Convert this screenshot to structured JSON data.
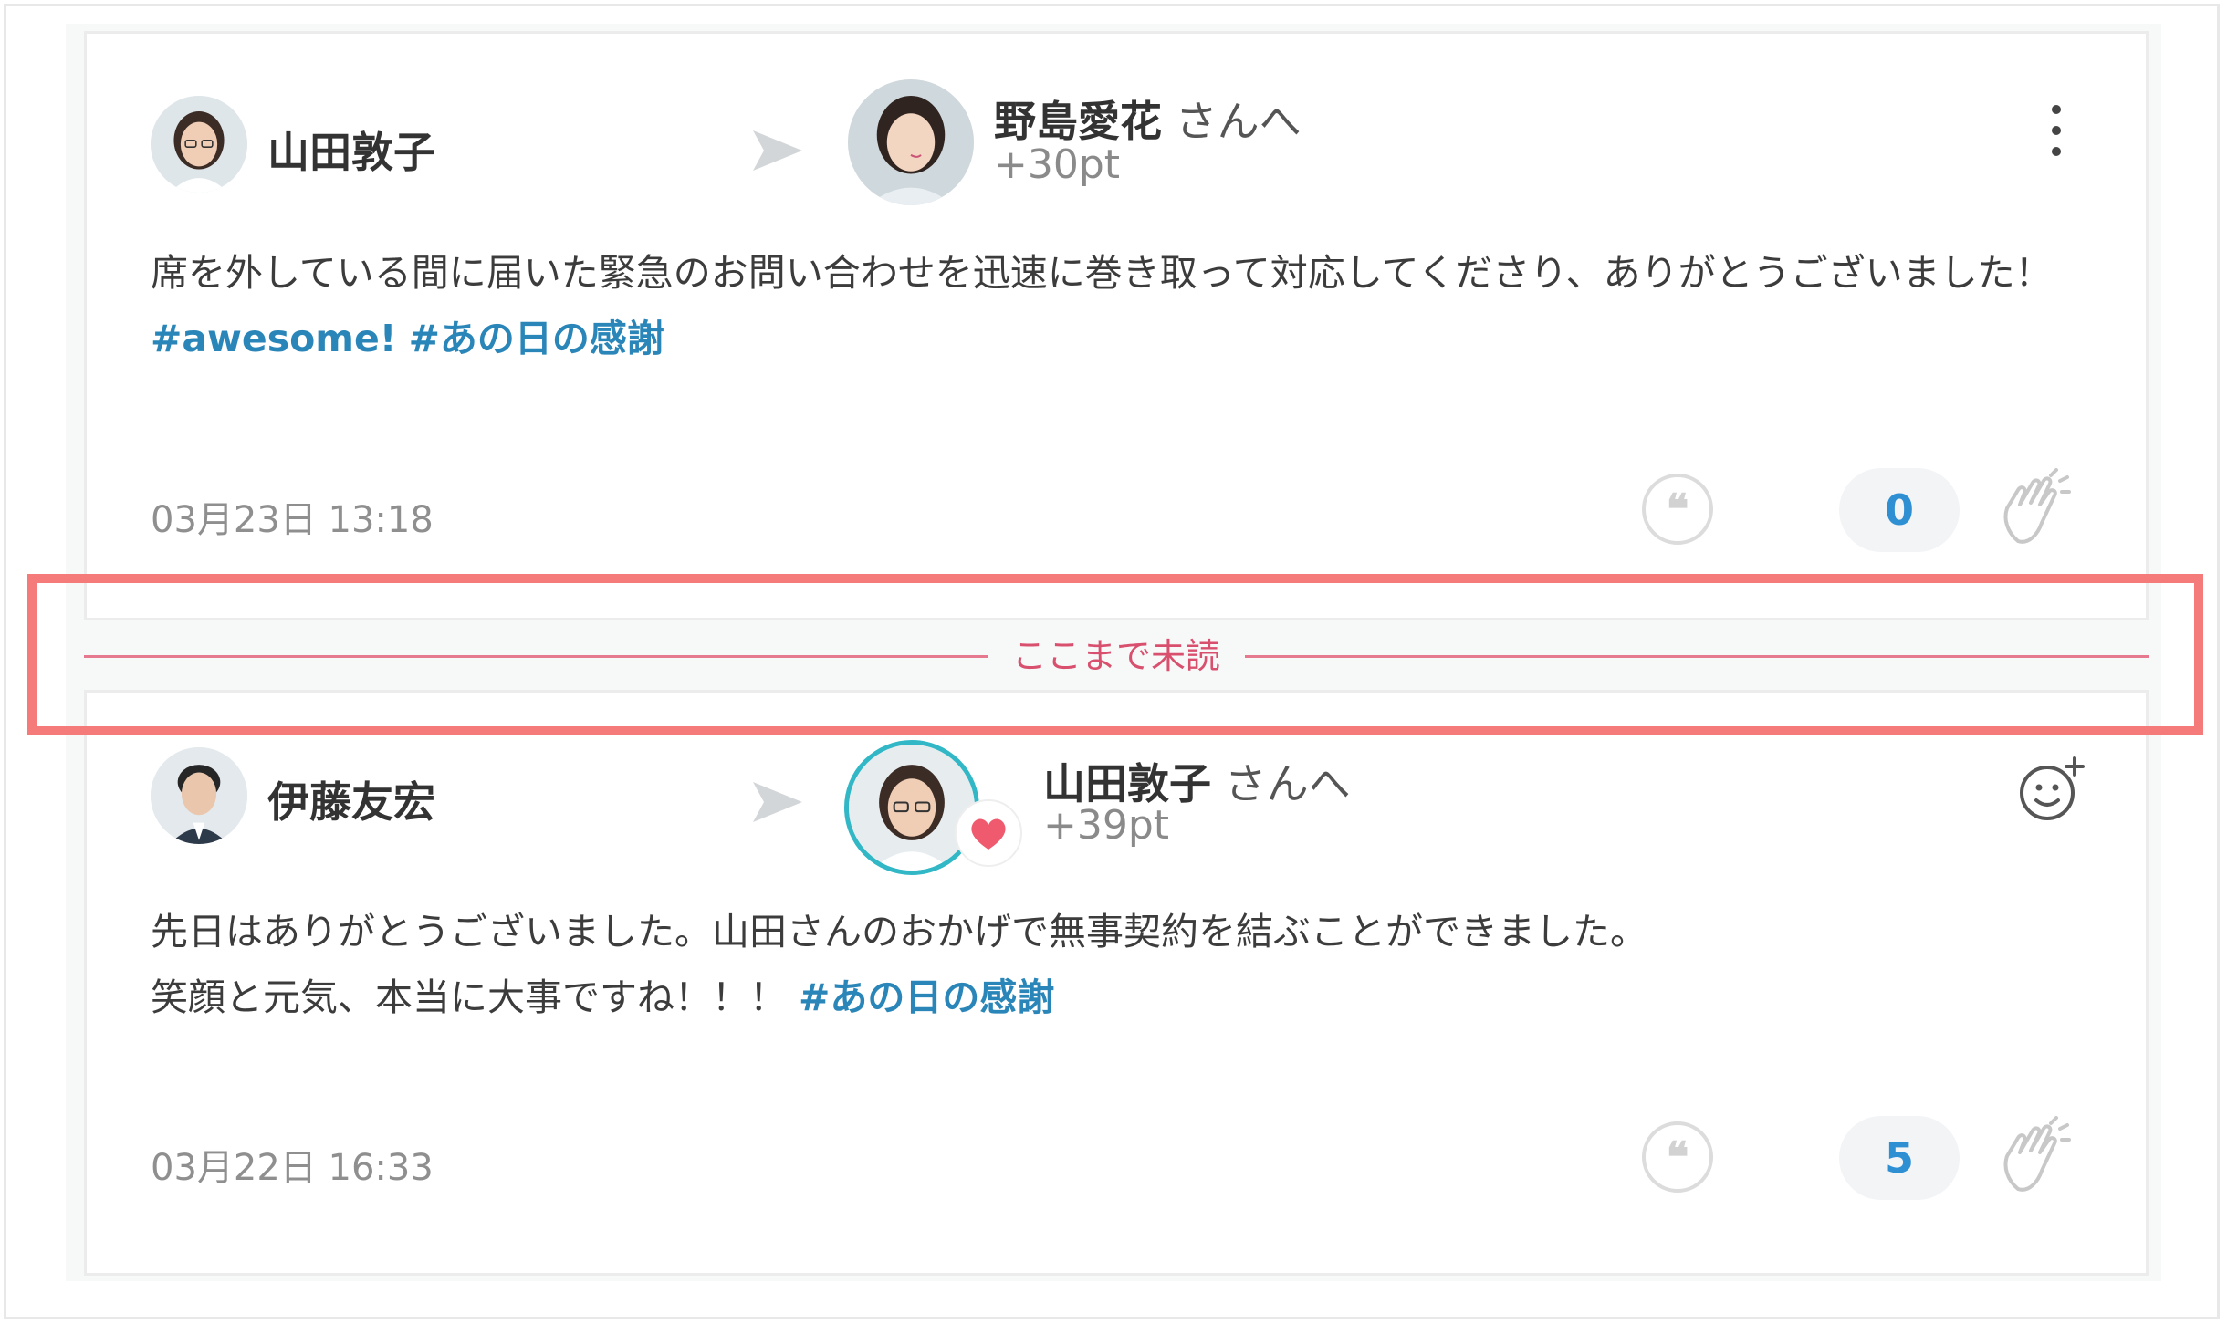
{
  "posts": [
    {
      "sender": {
        "name": "山田敦子"
      },
      "recipient": {
        "name": "野島愛花",
        "suffix": " さんへ",
        "points": "+30pt"
      },
      "message_line1": "席を外している間に届いた緊急のお問い合わせを迅速に巻き取って対応してくださり、ありがとうございました！",
      "hashtags": [
        "#awesome!",
        "#あの日の感謝"
      ],
      "timestamp": "03月23日 13:18",
      "clap_count": "0"
    },
    {
      "sender": {
        "name": "伊藤友宏"
      },
      "recipient": {
        "name": "山田敦子",
        "suffix": " さんへ",
        "points": "+39pt"
      },
      "message_line1": "先日はありがとうございました。山田さんのおかげで無事契約を結ぶことができました。",
      "message_line2": "笑顔と元気、本当に大事ですね！！！",
      "hashtags": [
        "#あの日の感謝"
      ],
      "timestamp": "03月22日 16:33",
      "clap_count": "5"
    }
  ],
  "unread_divider": {
    "label": "ここまで未読"
  },
  "colors": {
    "hashtag": "#2a86b8",
    "count": "#2f8fd3",
    "divider": "#e6788f",
    "highlight": "#f57a7a"
  },
  "icons": [
    "more-vertical-icon",
    "send-arrow-icon",
    "quote-icon",
    "clap-icon",
    "add-reaction-icon",
    "heart-badge-icon"
  ]
}
